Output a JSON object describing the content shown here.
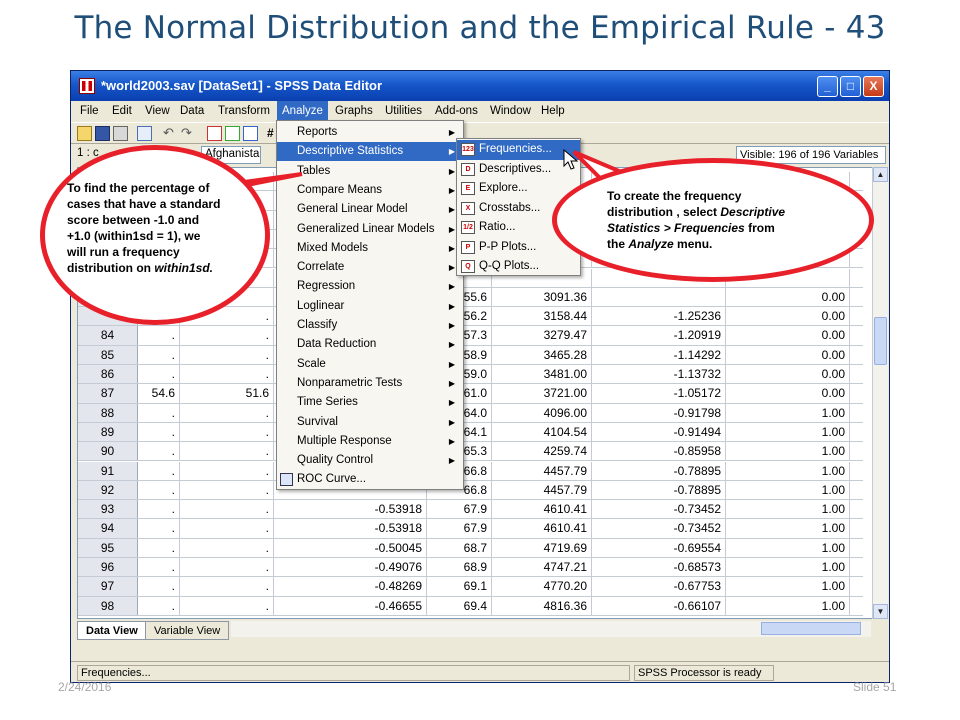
{
  "slide": {
    "title": "The Normal Distribution and the Empirical Rule - 43",
    "date": "2/24/2016",
    "slide_number": "Slide 51"
  },
  "window": {
    "title": "*world2003.sav [DataSet1] - SPSS Data Editor",
    "minimize": "_",
    "maximize": "□",
    "close": "X"
  },
  "menubar": [
    "File",
    "Edit",
    "View",
    "Data",
    "Transform",
    "Analyze",
    "Graphs",
    "Utilities",
    "Add-ons",
    "Window",
    "Help"
  ],
  "cellbar": {
    "ref": "1 : c",
    "value": "Afghanistan",
    "visible": "Visible: 196 of 196 Variables"
  },
  "analyze_menu": [
    {
      "label": "Reports",
      "submenu": true
    },
    {
      "label": "Descriptive Statistics",
      "submenu": true
    },
    {
      "label": "Tables",
      "submenu": true
    },
    {
      "label": "Compare Means",
      "submenu": true
    },
    {
      "label": "General Linear Model",
      "submenu": true
    },
    {
      "label": "Generalized Linear Models",
      "submenu": true
    },
    {
      "label": "Mixed Models",
      "submenu": true
    },
    {
      "label": "Correlate",
      "submenu": true
    },
    {
      "label": "Regression",
      "submenu": true
    },
    {
      "label": "Loglinear",
      "submenu": true
    },
    {
      "label": "Classify",
      "submenu": true
    },
    {
      "label": "Data Reduction",
      "submenu": true
    },
    {
      "label": "Scale",
      "submenu": true
    },
    {
      "label": "Nonparametric Tests",
      "submenu": true
    },
    {
      "label": "Time Series",
      "submenu": true
    },
    {
      "label": "Survival",
      "submenu": true
    },
    {
      "label": "Multiple Response",
      "submenu": true
    },
    {
      "label": "Quality Control",
      "submenu": true
    },
    {
      "label": "ROC Curve...",
      "submenu": false
    }
  ],
  "descriptive_submenu": [
    {
      "label": "Frequencies...",
      "icon": "123"
    },
    {
      "label": "Descriptives...",
      "icon": "D"
    },
    {
      "label": "Explore...",
      "icon": "E"
    },
    {
      "label": "Crosstabs...",
      "icon": "X"
    },
    {
      "label": "Ratio...",
      "icon": "1/2"
    },
    {
      "label": "P-P Plots...",
      "icon": "P"
    },
    {
      "label": "Q-Q Plots...",
      "icon": "Q"
    }
  ],
  "rows": [
    [
      "",
      "",
      "",
      "",
      "",
      "",
      "",
      ""
    ],
    [
      "",
      "",
      "",
      "",
      "",
      "",
      "",
      ""
    ],
    [
      "",
      "",
      "",
      "",
      "",
      "",
      "",
      ""
    ],
    [
      "",
      "",
      "",
      "",
      "",
      "",
      "",
      ""
    ],
    [
      "",
      "",
      "",
      "",
      "",
      "",
      "",
      ""
    ],
    [
      "",
      "",
      "",
      "",
      "",
      "",
      "",
      ""
    ],
    [
      "",
      "",
      "",
      "",
      "55.6",
      "3091.36",
      "",
      "0.00"
    ],
    [
      "",
      ".",
      ".",
      "",
      "56.2",
      "3158.44",
      "-1.25236",
      "0.00"
    ],
    [
      "84",
      ".",
      ".",
      "",
      "57.3",
      "3279.47",
      "-1.20919",
      "0.00"
    ],
    [
      "85",
      ".",
      ".",
      "",
      "58.9",
      "3465.28",
      "-1.14292",
      "0.00"
    ],
    [
      "86",
      ".",
      ".",
      "",
      "59.0",
      "3481.00",
      "-1.13732",
      "0.00"
    ],
    [
      "87",
      "54.6",
      "51.6",
      "",
      "61.0",
      "3721.00",
      "-1.05172",
      "0.00"
    ],
    [
      "88",
      ".",
      ".",
      "",
      "64.0",
      "4096.00",
      "-0.91798",
      "1.00"
    ],
    [
      "89",
      ".",
      ".",
      "",
      "64.1",
      "4104.54",
      "-0.91494",
      "1.00"
    ],
    [
      "90",
      ".",
      ".",
      "",
      "65.3",
      "4259.74",
      "-0.85958",
      "1.00"
    ],
    [
      "91",
      ".",
      ".",
      "",
      "66.8",
      "4457.79",
      "-0.78895",
      "1.00"
    ],
    [
      "92",
      ".",
      ".",
      "",
      "66.8",
      "4457.79",
      "-0.78895",
      "1.00"
    ],
    [
      "93",
      ".",
      ".",
      "-0.53918",
      "67.9",
      "4610.41",
      "-0.73452",
      "1.00"
    ],
    [
      "94",
      ".",
      ".",
      "-0.53918",
      "67.9",
      "4610.41",
      "-0.73452",
      "1.00"
    ],
    [
      "95",
      ".",
      ".",
      "-0.50045",
      "68.7",
      "4719.69",
      "-0.69554",
      "1.00"
    ],
    [
      "96",
      ".",
      ".",
      "-0.49076",
      "68.9",
      "4747.21",
      "-0.68573",
      "1.00"
    ],
    [
      "97",
      ".",
      ".",
      "-0.48269",
      "69.1",
      "4770.20",
      "-0.67753",
      "1.00"
    ],
    [
      "98",
      ".",
      ".",
      "-0.46655",
      "69.4",
      "4816.36",
      "-0.66107",
      "1.00"
    ]
  ],
  "tabs": [
    "Data View",
    "Variable View"
  ],
  "status": {
    "left": "Frequencies...",
    "right": "SPSS  Processor is ready"
  },
  "callout_left": {
    "line1": "To find the percentage of",
    "line2": "cases that have a standard",
    "line3": "score between -1.0 and",
    "line4": "+1.0 (within1sd = 1), we",
    "line5": "will run a frequency",
    "line6_a": "distribution on ",
    "line6_b": "within1sd."
  },
  "callout_right": {
    "line1": "To create the frequency",
    "line2_a": "distribution , select ",
    "line2_b": "Descriptive",
    "line3_a": "Statistics > Frequencies",
    "line3_b": " from",
    "line4_a": "the ",
    "line4_b": "Analyze",
    "line4_c": " menu."
  },
  "colors": {
    "title": "#1f4e79",
    "callout_border": "#e8202a",
    "highlight": "#316ac5"
  }
}
